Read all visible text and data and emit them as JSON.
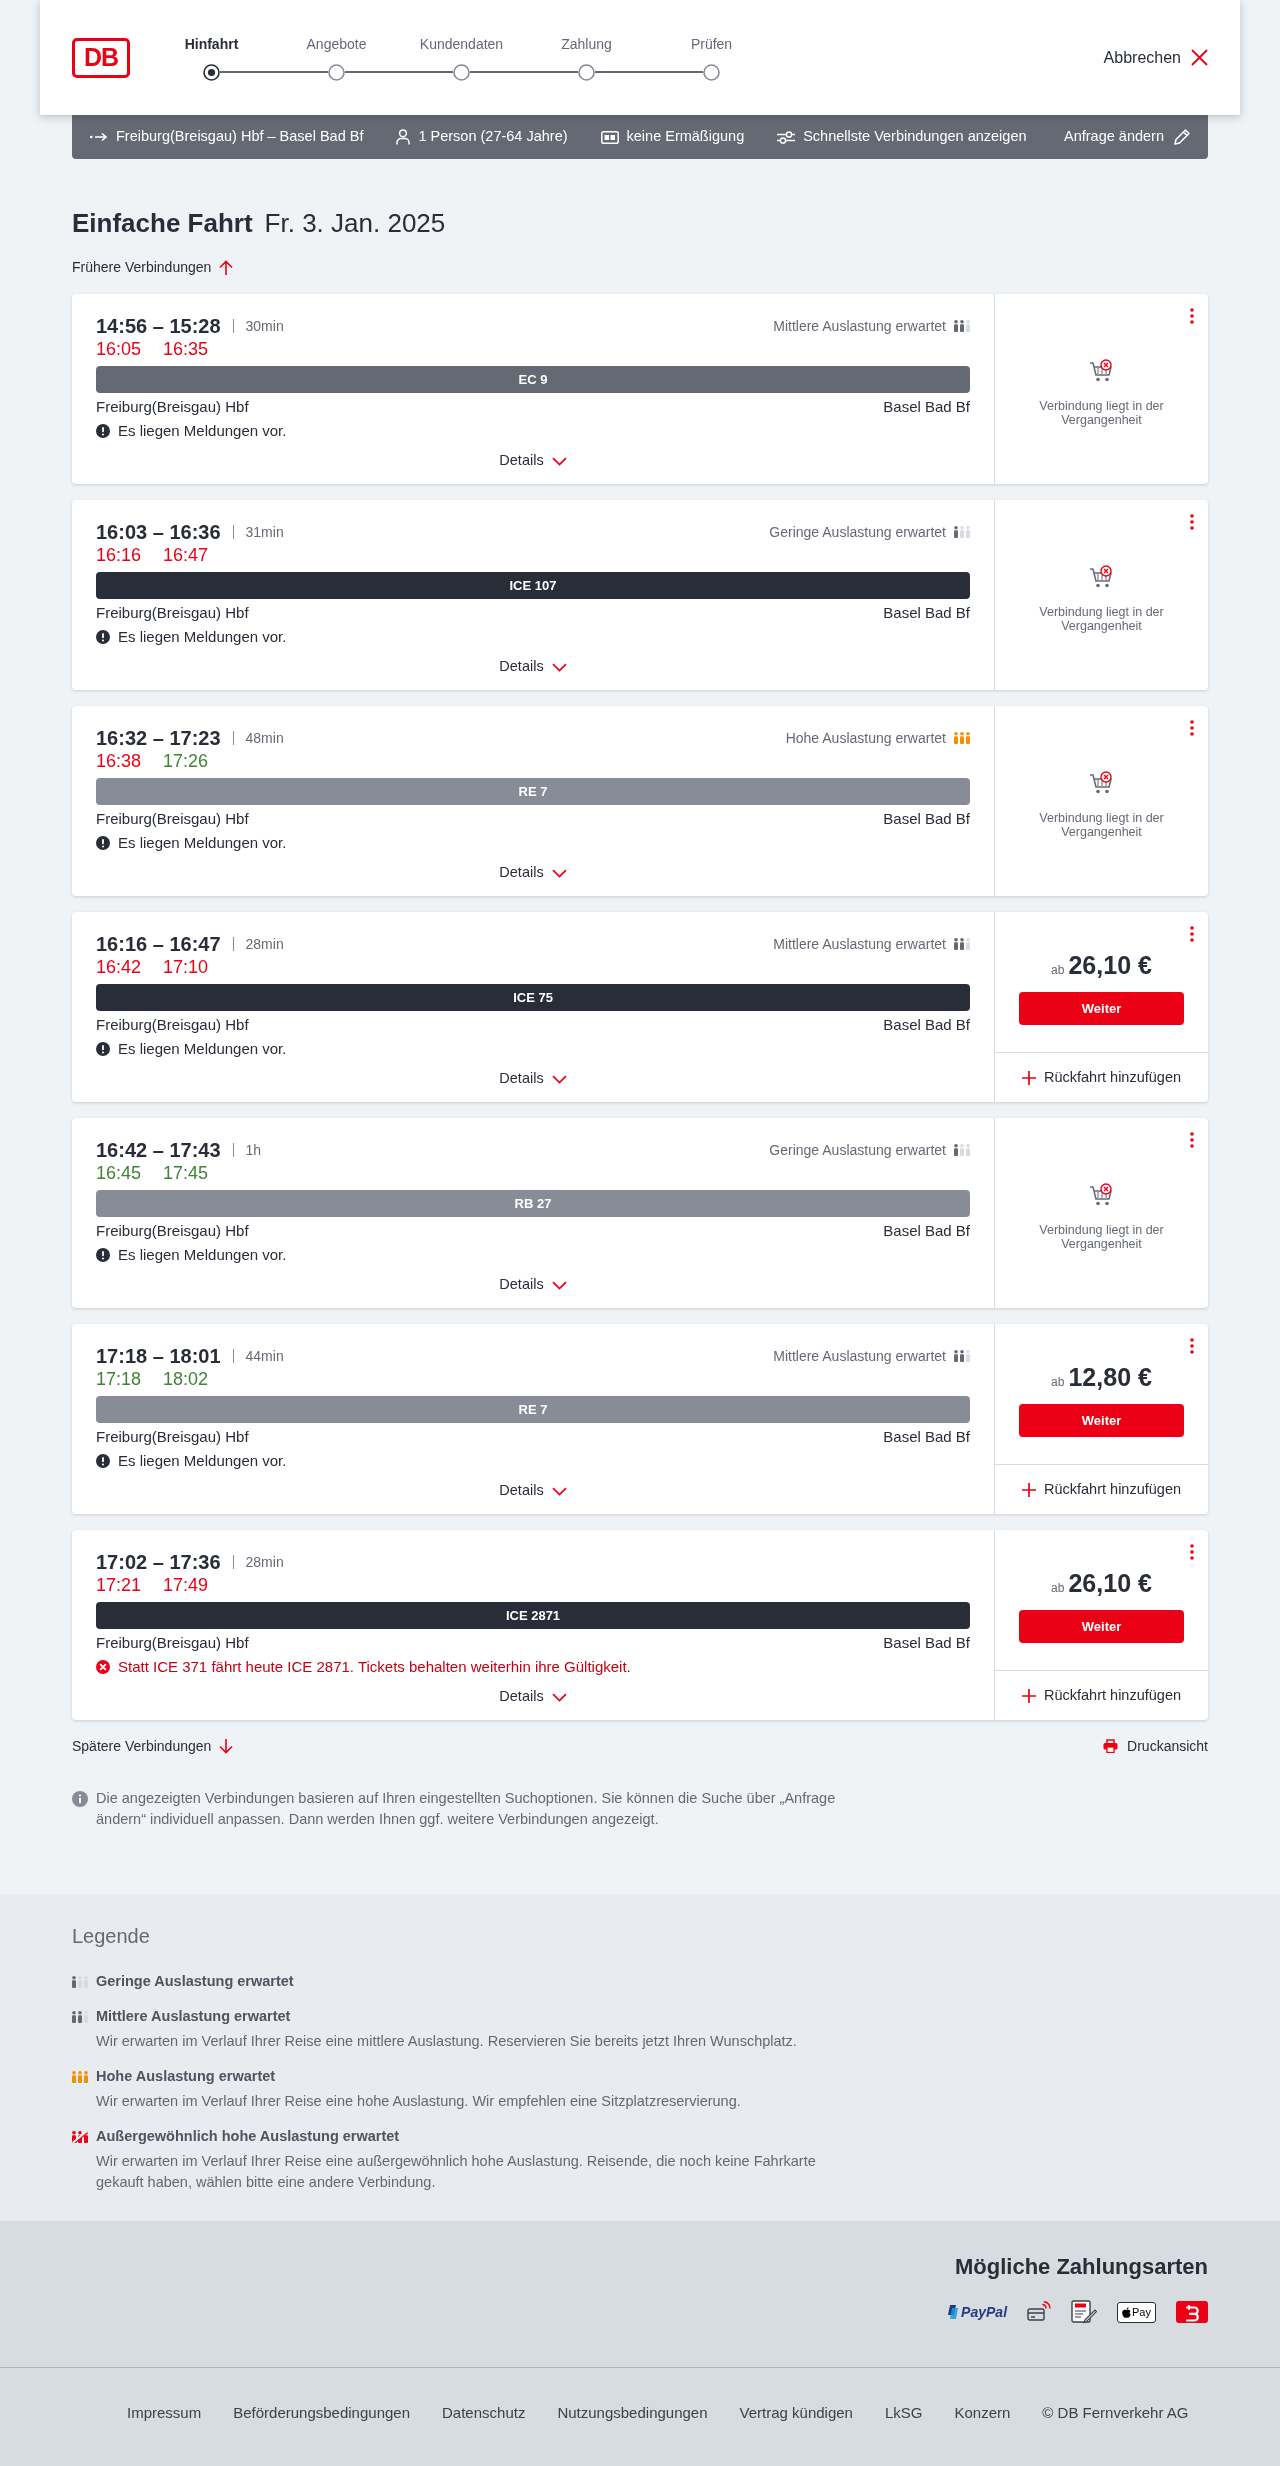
{
  "header": {
    "logo": "DB",
    "steps": [
      {
        "label": "Hinfahrt",
        "selected": true
      },
      {
        "label": "Angebote",
        "selected": false
      },
      {
        "label": "Kundendaten",
        "selected": false
      },
      {
        "label": "Zahlung",
        "selected": false
      },
      {
        "label": "Prüfen",
        "selected": false
      }
    ],
    "cancel": "Abbrechen"
  },
  "search_summary": {
    "route": "Freiburg(Breisgau) Hbf – Basel Bad Bf",
    "travellers": "1 Person (27-64 Jahre)",
    "discount": "keine Ermäßigung",
    "sorting": "Schnellste Verbindungen anzeigen",
    "edit": "Anfrage ändern"
  },
  "heading": {
    "title": "Einfache Fahrt",
    "date": "Fr. 3. Jan. 2025"
  },
  "earlier_link": "Frühere Verbindungen",
  "connections": [
    {
      "times": "14:56 – 15:28",
      "duration": "30min",
      "realtime": [
        {
          "time": "16:05",
          "delayed": true
        },
        {
          "time": "16:35",
          "delayed": true
        }
      ],
      "occupancy": {
        "kind": "medium",
        "label": "Mittlere Auslastung erwartet"
      },
      "train": {
        "name": "EC 9",
        "kind": "ec"
      },
      "from": "Freiburg(Breisgau) Hbf",
      "to": "Basel Bad Bf",
      "message": {
        "kind": "notice",
        "text": "Es liegen Meldungen vor."
      },
      "details": "Details",
      "offer": {
        "kind": "past",
        "text": "Verbindung liegt in der Vergangenheit"
      }
    },
    {
      "times": "16:03 – 16:36",
      "duration": "31min",
      "realtime": [
        {
          "time": "16:16",
          "delayed": true
        },
        {
          "time": "16:47",
          "delayed": true
        }
      ],
      "occupancy": {
        "kind": "low",
        "label": "Geringe Auslastung erwartet"
      },
      "train": {
        "name": "ICE 107",
        "kind": "ice"
      },
      "from": "Freiburg(Breisgau) Hbf",
      "to": "Basel Bad Bf",
      "message": {
        "kind": "notice",
        "text": "Es liegen Meldungen vor."
      },
      "details": "Details",
      "offer": {
        "kind": "past",
        "text": "Verbindung liegt in der Vergangenheit"
      }
    },
    {
      "times": "16:32 – 17:23",
      "duration": "48min",
      "realtime": [
        {
          "time": "16:38",
          "delayed": true
        },
        {
          "time": "17:26",
          "delayed": false
        }
      ],
      "occupancy": {
        "kind": "high",
        "label": "Hohe Auslastung erwartet"
      },
      "train": {
        "name": "RE 7",
        "kind": "regional"
      },
      "from": "Freiburg(Breisgau) Hbf",
      "to": "Basel Bad Bf",
      "message": {
        "kind": "notice",
        "text": "Es liegen Meldungen vor."
      },
      "details": "Details",
      "offer": {
        "kind": "past",
        "text": "Verbindung liegt in der Vergangenheit"
      }
    },
    {
      "times": "16:16 – 16:47",
      "duration": "28min",
      "realtime": [
        {
          "time": "16:42",
          "delayed": true
        },
        {
          "time": "17:10",
          "delayed": true
        }
      ],
      "occupancy": {
        "kind": "medium",
        "label": "Mittlere Auslastung erwartet"
      },
      "train": {
        "name": "ICE 75",
        "kind": "ice"
      },
      "from": "Freiburg(Breisgau) Hbf",
      "to": "Basel Bad Bf",
      "message": {
        "kind": "notice",
        "text": "Es liegen Meldungen vor."
      },
      "details": "Details",
      "offer": {
        "kind": "bookable",
        "prefix": "ab",
        "price": "26,10 €",
        "button": "Weiter",
        "return_trip": "Rückfahrt hinzufügen"
      }
    },
    {
      "times": "16:42 – 17:43",
      "duration": "1h",
      "realtime": [
        {
          "time": "16:45",
          "delayed": false
        },
        {
          "time": "17:45",
          "delayed": false
        }
      ],
      "occupancy": {
        "kind": "low",
        "label": "Geringe Auslastung erwartet"
      },
      "train": {
        "name": "RB 27",
        "kind": "regional"
      },
      "from": "Freiburg(Breisgau) Hbf",
      "to": "Basel Bad Bf",
      "message": {
        "kind": "notice",
        "text": "Es liegen Meldungen vor."
      },
      "details": "Details",
      "offer": {
        "kind": "past",
        "text": "Verbindung liegt in der Vergangenheit"
      }
    },
    {
      "times": "17:18 – 18:01",
      "duration": "44min",
      "realtime": [
        {
          "time": "17:18",
          "delayed": false
        },
        {
          "time": "18:02",
          "delayed": false
        }
      ],
      "occupancy": {
        "kind": "medium",
        "label": "Mittlere Auslastung erwartet"
      },
      "train": {
        "name": "RE 7",
        "kind": "regional"
      },
      "from": "Freiburg(Breisgau) Hbf",
      "to": "Basel Bad Bf",
      "message": {
        "kind": "notice",
        "text": "Es liegen Meldungen vor."
      },
      "details": "Details",
      "offer": {
        "kind": "bookable",
        "prefix": "ab",
        "price": "12,80 €",
        "button": "Weiter",
        "return_trip": "Rückfahrt hinzufügen"
      }
    },
    {
      "times": "17:02 – 17:36",
      "duration": "28min",
      "realtime": [
        {
          "time": "17:21",
          "delayed": true
        },
        {
          "time": "17:49",
          "delayed": true
        }
      ],
      "train": {
        "name": "ICE 2871",
        "kind": "ice"
      },
      "from": "Freiburg(Breisgau) Hbf",
      "to": "Basel Bad Bf",
      "message": {
        "kind": "disruption",
        "text": "Statt ICE 371 fährt heute ICE 2871. Tickets behalten weiterhin ihre Gültigkeit."
      },
      "details": "Details",
      "offer": {
        "kind": "bookable",
        "prefix": "ab",
        "price": "26,10 €",
        "button": "Weiter",
        "return_trip": "Rückfahrt hinzufügen"
      }
    }
  ],
  "later_link": "Spätere Verbindungen",
  "print_link": "Druckansicht",
  "info_note": "Die angezeigten Verbindungen basieren auf Ihren eingestellten Suchoptionen. Sie können die Suche über „Anfrage ändern“ individuell anpassen. Dann werden Ihnen ggf. weitere Verbindungen angezeigt.",
  "legend": {
    "title": "Legende",
    "items": [
      {
        "kind": "low",
        "title": "Geringe Auslastung erwartet"
      },
      {
        "kind": "medium",
        "title": "Mittlere Auslastung erwartet",
        "description": "Wir erwarten im Verlauf Ihrer Reise eine mittlere Auslastung. Reservieren Sie bereits jetzt Ihren Wunschplatz."
      },
      {
        "kind": "high",
        "title": "Hohe Auslastung erwartet",
        "description": "Wir erwarten im Verlauf Ihrer Reise eine hohe Auslastung. Wir empfehlen eine Sitzplatzreservierung."
      },
      {
        "kind": "exceptional",
        "title": "Außergewöhnlich hohe Auslastung erwartet",
        "description": "Wir erwarten im Verlauf Ihrer Reise eine außergewöhnlich hohe Auslastung. Reisende, die noch keine Fahrkarte gekauft haben, wählen bitte eine andere Verbindung."
      }
    ]
  },
  "payment": {
    "title": "Mögliche Zahlungsarten",
    "methods": [
      {
        "kind": "paypal",
        "label": "PayPal"
      },
      {
        "kind": "contactless"
      },
      {
        "kind": "sepa"
      },
      {
        "kind": "apple_pay",
        "label": "Pay"
      },
      {
        "kind": "tile"
      }
    ]
  },
  "footer": {
    "links": [
      "Impressum",
      "Beförderungsbedingungen",
      "Datenschutz",
      "Nutzungsbedingungen",
      "Vertrag kündigen",
      "LkSG",
      "Konzern"
    ],
    "copyright": "© DB Fernverkehr AG"
  }
}
